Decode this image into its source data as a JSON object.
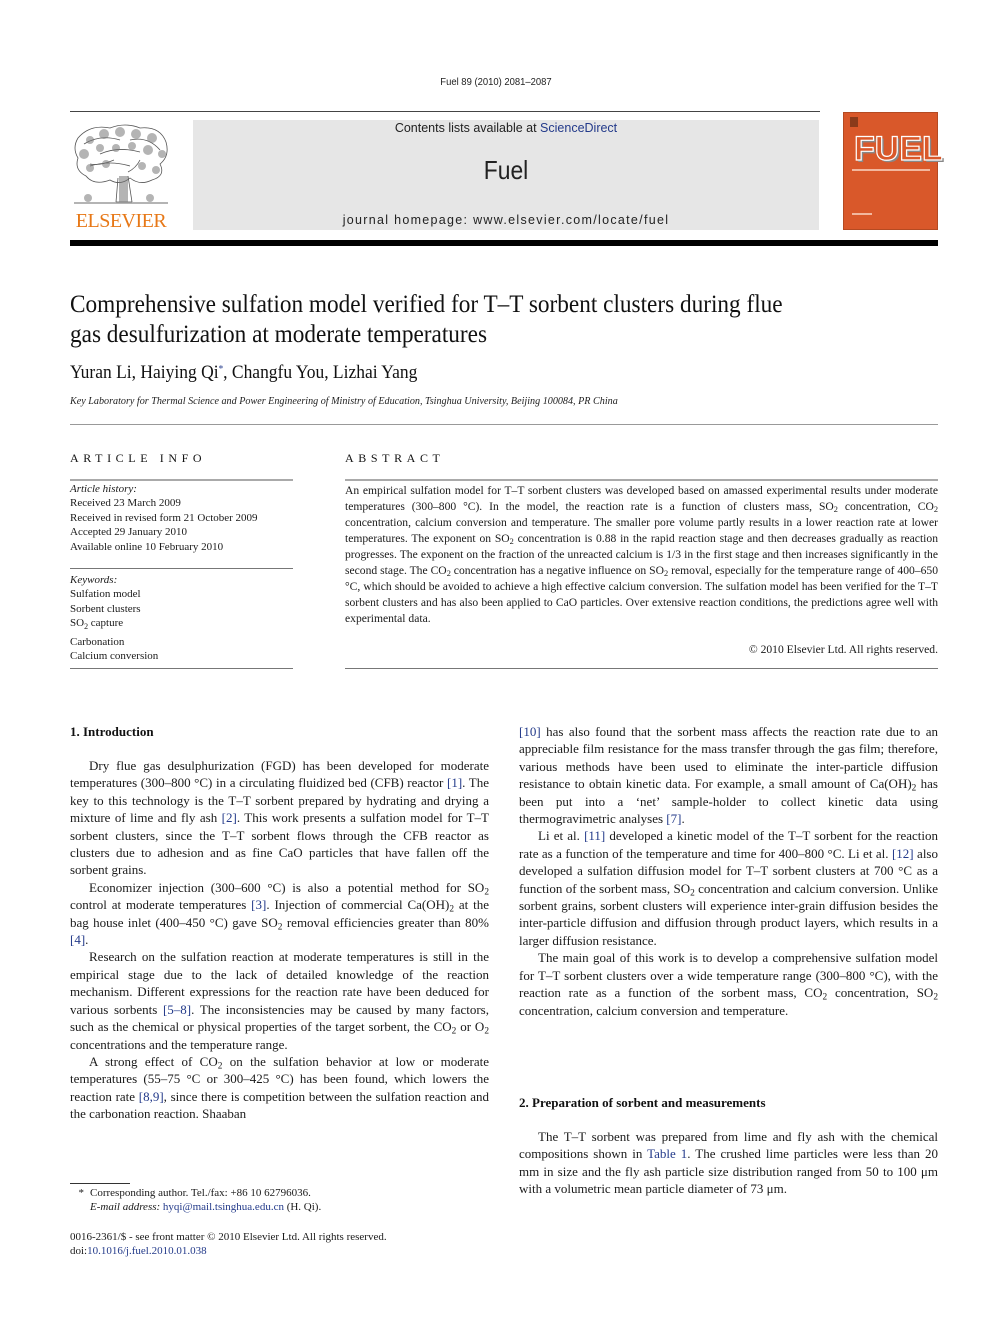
{
  "running_head": "Fuel 89 (2010) 2081–2087",
  "masthead": {
    "publisher_logo_text": "ELSEVIER",
    "contents_prefix": "Contents lists available at ",
    "contents_link": "ScienceDirect",
    "journal_name": "Fuel",
    "homepage": "journal homepage: www.elsevier.com/locate/fuel",
    "cover_title": "FUEL",
    "colors": {
      "publisher_orange": "#e77817",
      "cover_orange": "#d9582a",
      "link_blue": "#233a8a",
      "masthead_gray": "#e6e6e6"
    }
  },
  "article": {
    "title_line1": "Comprehensive sulfation model verified for T–T sorbent clusters during flue",
    "title_line2": "gas desulfurization at moderate temperatures",
    "authors": [
      {
        "name": "Yuran Li",
        "sep": ", "
      },
      {
        "name": "Haiying Qi",
        "mark": "*",
        "sep": ", "
      },
      {
        "name": "Changfu You",
        "sep": ", "
      },
      {
        "name": "Lizhai Yang",
        "sep": ""
      }
    ],
    "affiliation": "Key Laboratory for Thermal Science and Power Engineering of Ministry of Education, Tsinghua University, Beijing 100084, PR China"
  },
  "article_info": {
    "heading": "ARTICLE INFO",
    "history_label": "Article history:",
    "history": [
      "Received 23 March 2009",
      "Received in revised form 21 October 2009",
      "Accepted 29 January 2010",
      "Available online 10 February 2010"
    ],
    "keywords_label": "Keywords:",
    "keywords": [
      "Sulfation model",
      "Sorbent clusters",
      "SO2 capture",
      "Carbonation",
      "Calcium conversion"
    ]
  },
  "abstract": {
    "heading": "ABSTRACT",
    "text": [
      "An empirical sulfation model for T–T sorbent clusters was developed based on amassed experimental results under moderate temperatures (300–800 °C). In the model, the reaction rate is a function of clusters mass, ",
      "SO2",
      " concentration, ",
      "CO2",
      " concentration, calcium conversion and temperature. The smaller pore volume partly results in a lower reaction rate at lower temperatures. The exponent on ",
      "SO2",
      " concentration is 0.88 in the rapid reaction stage and then decreases gradually as reaction progresses. The exponent on the fraction of the unreacted calcium is 1/3 in the first stage and then increases significantly in the second stage. The ",
      "CO2",
      " concentration has a negative influence on ",
      "SO2",
      " removal, especially for the temperature range of 400–650 °C, which should be avoided to achieve a high effective calcium conversion. The sulfation model has been verified for the T–T sorbent clusters and has also been applied to CaO particles. Over extensive reaction conditions, the predictions agree well with experimental data."
    ],
    "copyright": "© 2010 Elsevier Ltd. All rights reserved."
  },
  "body": {
    "section1_heading": "1. Introduction",
    "section2_heading": "2. Preparation of sorbent and measurements",
    "left_paragraphs": [
      [
        {
          "t": "Dry flue gas desulphurization (FGD) has been developed for moderate temperatures (300–800 °C) in a circulating fluidized bed (CFB) reactor "
        },
        {
          "c": "[1]"
        },
        {
          "t": ". The key to this technology is the T–T sorbent prepared by hydrating and drying a mixture of lime and fly ash "
        },
        {
          "c": "[2]"
        },
        {
          "t": ". This work presents a sulfation model for T–T sorbent clusters, since the T–T sorbent flows through the CFB reactor as clusters due to adhesion and as fine CaO particles that have fallen off the sorbent grains."
        }
      ],
      [
        {
          "t": "Economizer injection (300–600 °C) is also a potential method for SO"
        },
        {
          "s": "2"
        },
        {
          "t": " control at moderate temperatures "
        },
        {
          "c": "[3]"
        },
        {
          "t": ". Injection of commercial Ca(OH)"
        },
        {
          "s": "2"
        },
        {
          "t": " at the bag house inlet (400–450 °C) gave SO"
        },
        {
          "s": "2"
        },
        {
          "t": " removal efficiencies greater than 80% "
        },
        {
          "c": "[4]"
        },
        {
          "t": "."
        }
      ],
      [
        {
          "t": "Research on the sulfation reaction at moderate temperatures is still in the empirical stage due to the lack of detailed knowledge of the reaction mechanism. Different expressions for the reaction rate have been deduced for various sorbents "
        },
        {
          "c": "[5–8]"
        },
        {
          "t": ". The inconsistencies may be caused by many factors, such as the chemical or physical properties of the target sorbent, the CO"
        },
        {
          "s": "2"
        },
        {
          "t": " or O"
        },
        {
          "s": "2"
        },
        {
          "t": " concentrations and the temperature range."
        }
      ],
      [
        {
          "t": "A strong effect of CO"
        },
        {
          "s": "2"
        },
        {
          "t": " on the sulfation behavior at low or moderate temperatures (55–75 °C or 300–425 °C) has been found, which lowers the reaction rate "
        },
        {
          "c": "[8,9]"
        },
        {
          "t": ", since there is competition between the sulfation reaction and the carbonation reaction. Shaaban"
        }
      ]
    ],
    "right_paragraphs": [
      [
        {
          "c": "[10]"
        },
        {
          "t": " has also found that the sorbent mass affects the reaction rate due to an appreciable film resistance for the mass transfer through the gas film; therefore, various methods have been used to eliminate the inter-particle diffusion resistance to obtain kinetic data. For example, a small amount of Ca(OH)"
        },
        {
          "s": "2"
        },
        {
          "t": " has been put into a ‘net’ sample-holder to collect kinetic data using thermogravimetric analyses "
        },
        {
          "c": "[7]"
        },
        {
          "t": "."
        }
      ],
      [
        {
          "t": "Li et al. "
        },
        {
          "c": "[11]"
        },
        {
          "t": " developed a kinetic model of the T–T sorbent for the reaction rate as a function of the temperature and time for 400–800 °C. Li et al. "
        },
        {
          "c": "[12]"
        },
        {
          "t": " also developed a sulfation diffusion model for T–T sorbent clusters at 700 °C as a function of the sorbent mass, SO"
        },
        {
          "s": "2"
        },
        {
          "t": " concentration and calcium conversion. Unlike sorbent grains, sorbent clusters will experience inter-grain diffusion besides the inter-particle diffusion and diffusion through product layers, which results in a larger diffusion resistance."
        }
      ],
      [
        {
          "t": "The main goal of this work is to develop a comprehensive sulfation model for T–T sorbent clusters over a wide temperature range (300–800 °C), with the reaction rate as a function of the sorbent mass, CO"
        },
        {
          "s": "2"
        },
        {
          "t": " concentration, SO"
        },
        {
          "s": "2"
        },
        {
          "t": " concentration, calcium conversion and temperature."
        }
      ]
    ],
    "section2_paragraphs": [
      [
        {
          "t": "The T–T sorbent was prepared from lime and fly ash with the chemical compositions shown in "
        },
        {
          "c": "Table 1"
        },
        {
          "t": ". The crushed lime particles were less than 20 mm in size and the fly ash particle size distribution ranged from 50 to 100 μm with a volumetric mean particle diameter of 73 μm."
        }
      ]
    ]
  },
  "footnote": {
    "mark": "*",
    "corresponding": "Corresponding author. Tel./fax: +86 10 62796036.",
    "email_label": "E-mail address: ",
    "email": "hyqi@mail.tsinghua.edu.cn",
    "email_suffix": " (H. Qi)."
  },
  "imprint": {
    "line1": "0016-2361/$ - see front matter © 2010 Elsevier Ltd. All rights reserved.",
    "doi_prefix": "doi:",
    "doi": "10.1016/j.fuel.2010.01.038"
  }
}
